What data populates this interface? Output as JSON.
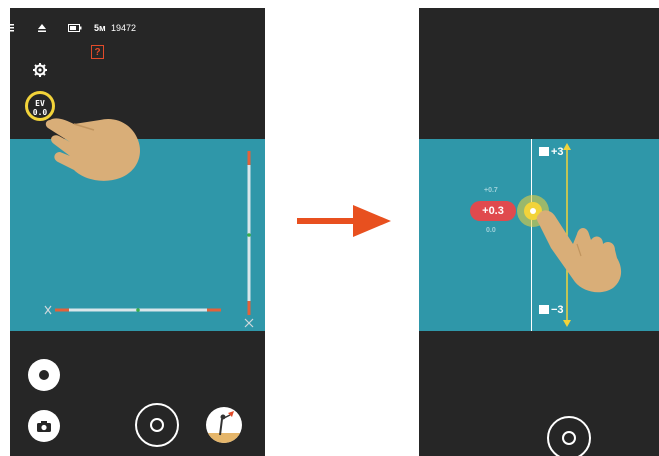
{
  "left_screen": {
    "status": {
      "menu_icon": "menu-icon",
      "eject_icon": "eject-icon",
      "battery_icon": "battery-icon",
      "mode": "5м",
      "shots_remaining": "19472"
    },
    "help_label": "?",
    "ev_button": {
      "line1": "EV",
      "line2": "0.0"
    }
  },
  "right_screen": {
    "ev_current": "+0.3",
    "ev_next": "+0.7",
    "ev_prev": "0.0",
    "ev_max": "+3",
    "ev_min": "−3"
  },
  "colors": {
    "phone_bg": "#262626",
    "preview_bg": "#2f97a9",
    "ev_highlight": "#f2d33a",
    "ev_pill": "#e04a4e",
    "arrow": "#e8501f"
  }
}
